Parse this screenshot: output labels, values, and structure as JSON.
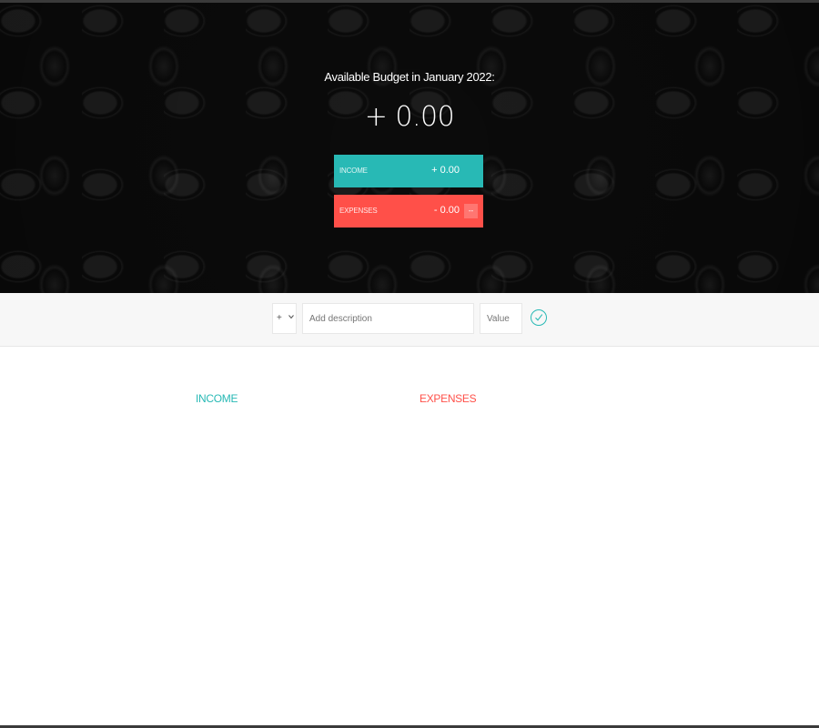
{
  "header": {
    "title": "Available Budget in January 2022:",
    "total": "+ 0.00"
  },
  "summary": {
    "income": {
      "label": "INCOME",
      "value": "+ 0.00"
    },
    "expenses": {
      "label": "EXPENSES",
      "value": "- 0.00",
      "percentage": "--"
    }
  },
  "add_form": {
    "type_selected": "+",
    "description_placeholder": "Add description",
    "value_placeholder": "Value",
    "submit_icon": "check-circle-icon"
  },
  "lists": {
    "income_title": "INCOME",
    "expenses_title": "EXPENSES"
  },
  "colors": {
    "income": "#28b9b5",
    "expenses": "#ff5049",
    "hero_bg": "#0b0b0b",
    "bar_bg": "#f7f7f7"
  }
}
